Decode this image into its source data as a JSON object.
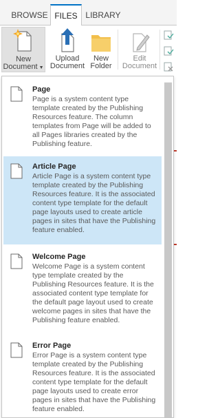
{
  "tabs": [
    {
      "label": "BROWSE"
    },
    {
      "label": "FILES"
    },
    {
      "label": "LIBRARY"
    }
  ],
  "ribbon": {
    "new_document": {
      "line1": "New",
      "line2": "Document",
      "icon": "new-document-icon"
    },
    "upload_document": {
      "line1": "Upload",
      "line2": "Document",
      "icon": "upload-icon"
    },
    "new_folder": {
      "line1": "New",
      "line2": "Folder",
      "icon": "folder-icon"
    },
    "edit_document": {
      "line1": "Edit",
      "line2": "Document",
      "icon": "edit-document-icon"
    }
  },
  "menu": {
    "items": [
      {
        "title": "Page",
        "description": "Page is a system content type template created by the Publishing Resources feature. The column templates from Page will be added to all Pages libraries created by the Publishing feature.",
        "selected": false
      },
      {
        "title": "Article Page",
        "description": "Article Page is a system content type template created by the Publishing Resources feature. It is the associated content type template for the default page layouts used to create article pages in sites that have the Publishing feature enabled.",
        "selected": true
      },
      {
        "title": "Welcome Page",
        "description": "Welcome Page is a system content type template created by the Publishing Resources feature. It is the associated content type template for the default page layout used to create welcome pages in sites that have the Publishing feature enabled.",
        "selected": false
      },
      {
        "title": "Error Page",
        "description": "Error Page is a system content type template created by the Publishing Resources feature. It is the associated content type template for the default page layouts used to create error pages in sites that have the Publishing feature enabled.",
        "selected": false
      }
    ]
  },
  "colors": {
    "accent": "#0072c6",
    "selected_bg": "#cde6f7",
    "folder": "#f2bf4b"
  }
}
